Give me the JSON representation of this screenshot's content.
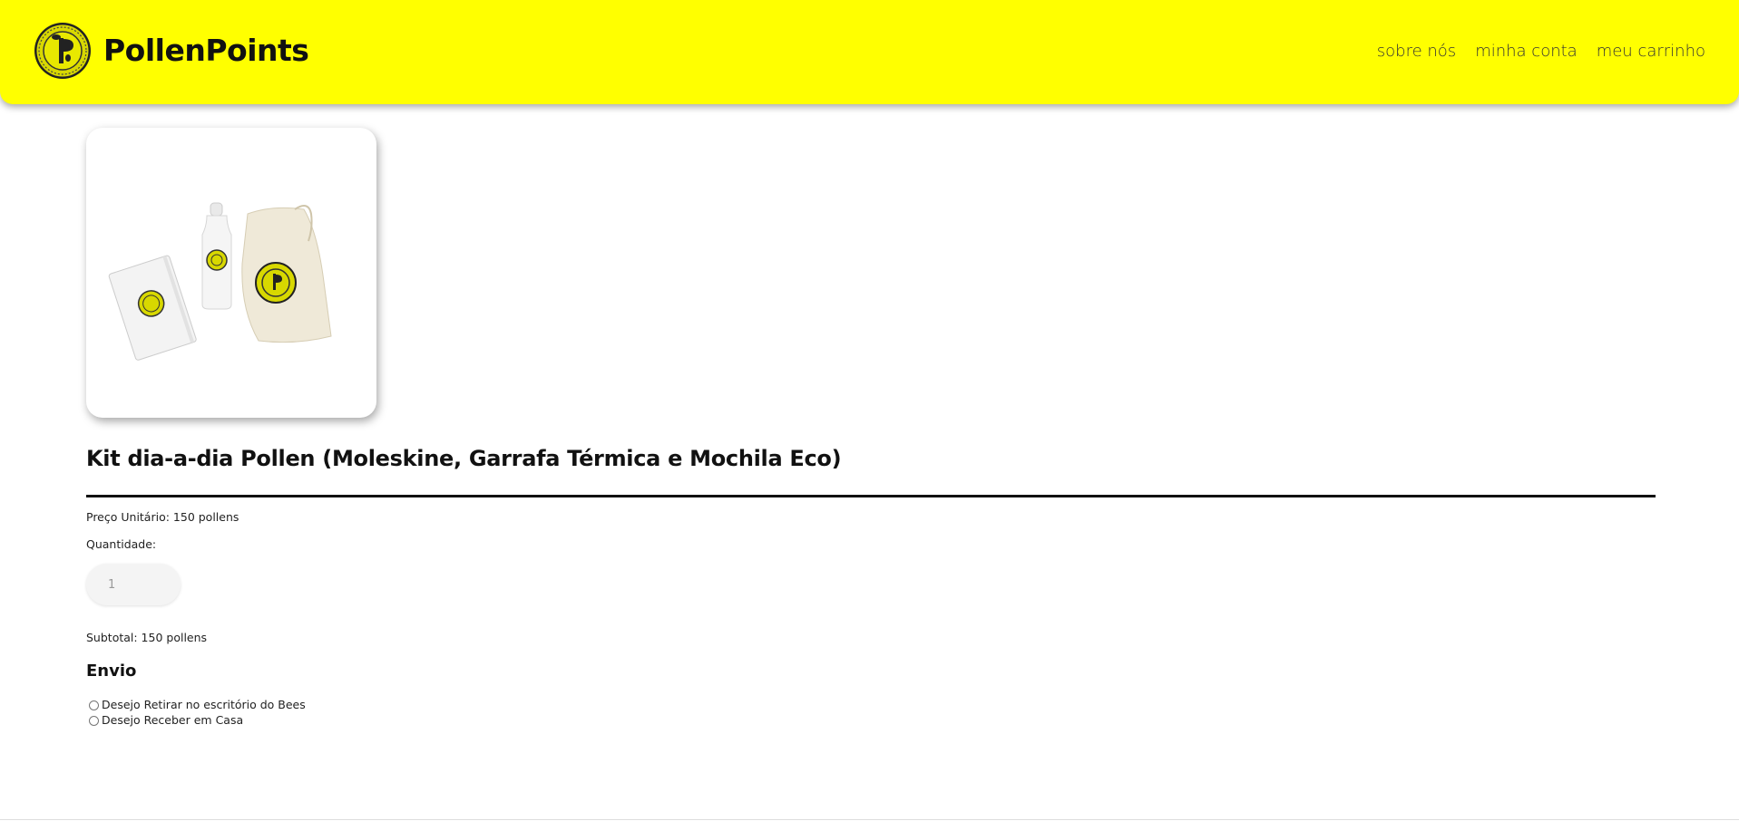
{
  "header": {
    "brand": "PollenPoints",
    "logo_icon": "bee-coin-logo-icon",
    "background_color": "#ffff00",
    "nav": [
      {
        "label": "sobre nós"
      },
      {
        "label": "minha conta"
      },
      {
        "label": "meu carrinho"
      }
    ]
  },
  "product": {
    "image_icon": "product-kit-image",
    "title": "Kit dia-a-dia Pollen (Moleskine, Garrafa Térmica e Mochila Eco)",
    "price_text": "Preço Unitário: 150 pollens",
    "quantity_label": "Quantidade:",
    "quantity_value": "1",
    "subtotal_text": "Subtotal: 150 pollens"
  },
  "shipping": {
    "title": "Envio",
    "options": [
      {
        "label": "Desejo Retirar no escritório do Bees",
        "selected": false
      },
      {
        "label": "Desejo Receber em Casa",
        "selected": false
      }
    ]
  }
}
